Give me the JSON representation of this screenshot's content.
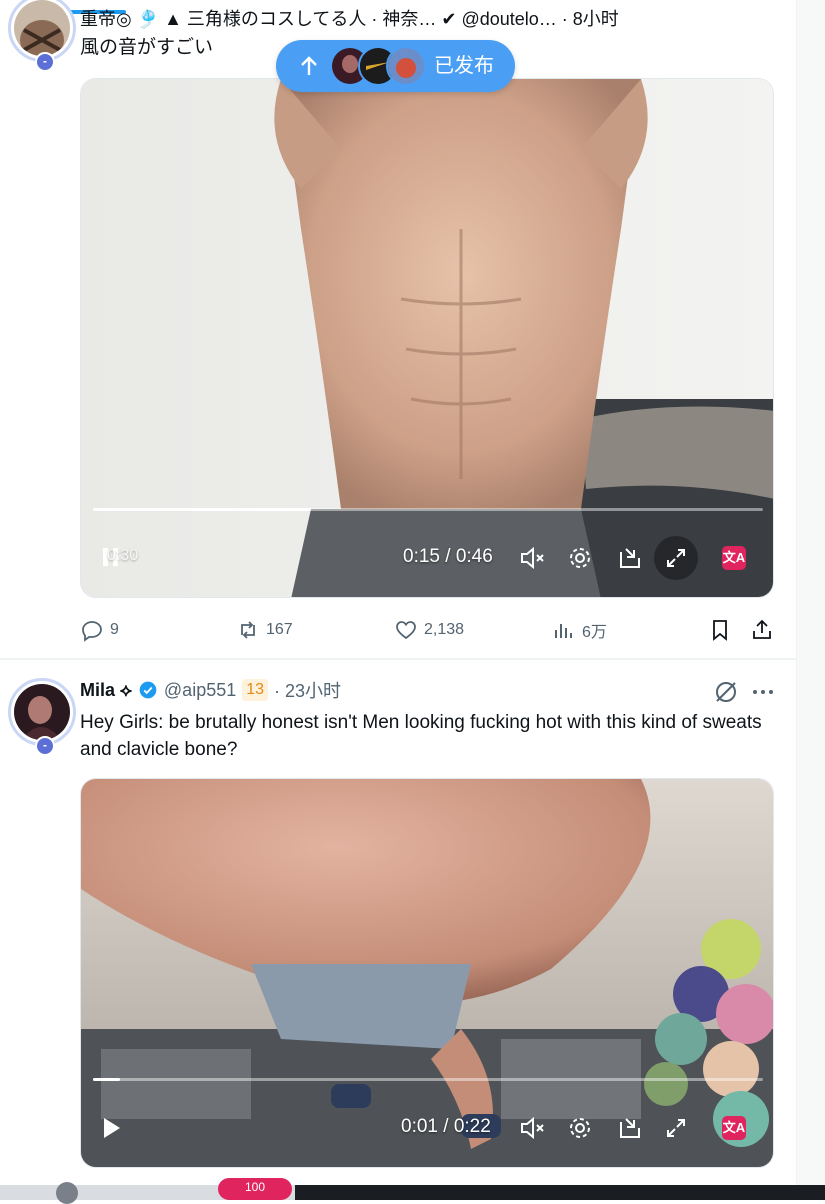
{
  "pill": {
    "label": "已发布"
  },
  "tweet1": {
    "header_partial": "重帝◎ 🎐 ▲ 三角様のコスしてる人 · 神奈… ✔ @doutelo… · 8小时",
    "text": "風の音がすごい",
    "video": {
      "current": "0:15",
      "total": "0:46",
      "time_sep": " / ",
      "overlay_time": "0:30",
      "progress": 0.326
    },
    "actions": {
      "replies": "9",
      "reposts": "167",
      "likes": "2,138",
      "views": "6万"
    },
    "avatar_badge": "-"
  },
  "tweet2": {
    "name": "Mila ⟡",
    "handle": "@aip551",
    "level": "13",
    "time": "· 23小时",
    "text": "Hey Girls: be brutally honest isn't Men looking fucking hot with this kind of sweats and clavicle bone?",
    "video": {
      "current": "0:01",
      "total": "0:22",
      "time_sep": " / ",
      "progress": 0.04
    },
    "avatar_badge": "-"
  },
  "translate_label": "文A",
  "bottom": {
    "badge": "100"
  },
  "colors": {
    "accent": "#1d9bf0",
    "pill": "#4a9ff5",
    "translate": "#e0245e",
    "muted": "#536471"
  }
}
